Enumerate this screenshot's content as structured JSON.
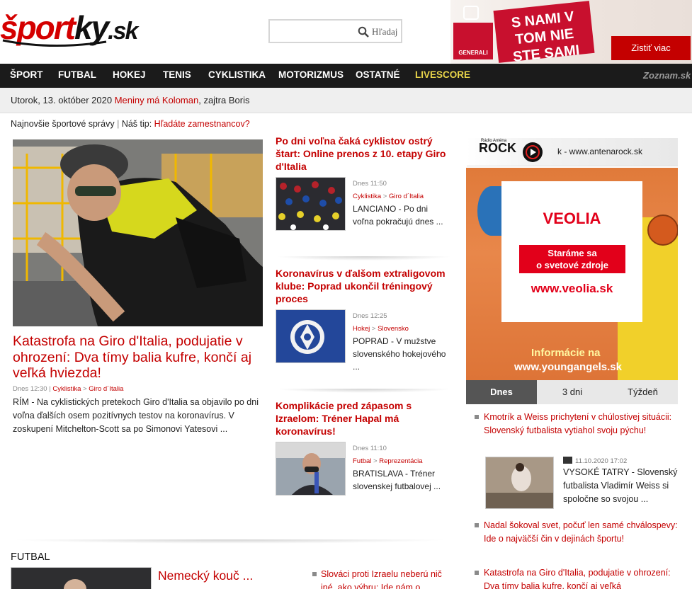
{
  "header": {
    "logo": {
      "part1": "šport",
      "part2": "ky",
      "part3": ".sk"
    },
    "search": {
      "placeholder": "",
      "label": "Hľadaj"
    },
    "ad": {
      "brand": "GENERALI",
      "slogan": "S NAMI V TOM NIE STE SAMI",
      "cta": "Zistiť viac"
    }
  },
  "nav": {
    "items": [
      "ŠPORT",
      "FUTBAL",
      "HOKEJ",
      "TENIS",
      "CYKLISTIKA",
      "MOTORIZMUS",
      "OSTATNÉ",
      "LIVESCORE"
    ],
    "zoznam": "Zoznam.sk"
  },
  "datebar": {
    "day": "Utorok",
    "date": ", 13. október 2020 ",
    "namedays": "Meniny má Koloman",
    "tomorrow": ", zajtra Boris"
  },
  "tips": {
    "news": "Najnovšie športové správy",
    "sep": " | ",
    "tip_label": "Náš tip: ",
    "tip_link": "Hľadáte zamestnancov?"
  },
  "main_article": {
    "title": "Katastrofa na Giro d'Italia, podujatie v ohrození: Dva tímy balia kufre, končí aj veľká hviezda!",
    "time": "Dnes 12:30",
    "cat1": "Cyklistika",
    "cat2": "Giro d´Italia",
    "text": "RÍM - Na cyklistických pretekoch Giro d'Italia sa objavilo po dni voľna ďalších osem pozitívnych testov na koronavírus. V zoskupení Mitchelton-Scott sa po Simonovi Yatesovi ..."
  },
  "mid_articles": [
    {
      "title": "Po dni voľna čaká cyklistov ostrý štart: Online prenos z 10. etapy Giro d'Italia",
      "time": "Dnes 11:50",
      "cat1": "Cyklistika",
      "cat2": "Giro d´Italia",
      "text": "LANCIANO - Po dni voľna pokračujú dnes ..."
    },
    {
      "title": "Koronavírus v ďalšom extraligovom klube: Poprad ukončil tréningový proces",
      "time": "Dnes 12:25",
      "cat1": "Hokej",
      "cat2": "Slovensko",
      "text": "POPRAD - V mužstve slovenského hokejového ..."
    },
    {
      "title": "Komplikácie pred zápasom s Izraelom: Tréner Hapal má koronavírus!",
      "time": "Dnes 11:10",
      "cat1": "Futbal",
      "cat2": "Reprezentácia",
      "text": "BRATISLAVA - Tréner slovenskej futbalovej ..."
    }
  ],
  "right": {
    "radio": {
      "small": "Rádio Anténa",
      "name": "ROCK",
      "url": "k - www.antenarock.sk"
    },
    "veolia": {
      "brand": "VEOLIA",
      "tagline1": "Staráme sa",
      "tagline2": "o svetové zdroje",
      "url": "www.veolia.sk",
      "info1": "Informácie na",
      "info2": "www.youngangels.sk"
    },
    "tabs": [
      "Dnes",
      "3 dni",
      "Týždeň"
    ],
    "list": [
      "Kmotrík a Weiss prichytení v chúlostivej situácii: Slovenský futbalista vytiahol svoju pýchu!",
      "Nadal šokoval svet, počuť len samé chválospevy: Ide o najväčší čin v dejinách športu!",
      "Katastrofa na Giro d'Italia, podujatie v ohrození: Dva tímy balia kufre, končí aj veľká"
    ],
    "featured": {
      "date": "11.10.2020 17:02",
      "text": "VYSOKÉ TATRY - Slovenský futbalista Vladimír Weiss si spoločne so svojou ..."
    }
  },
  "futbal_section": {
    "heading": "FUTBAL",
    "title": "Nemecký kouč ...",
    "item": "Slováci proti Izraelu neberú nič iné, ako výhru: Ide nám o"
  }
}
